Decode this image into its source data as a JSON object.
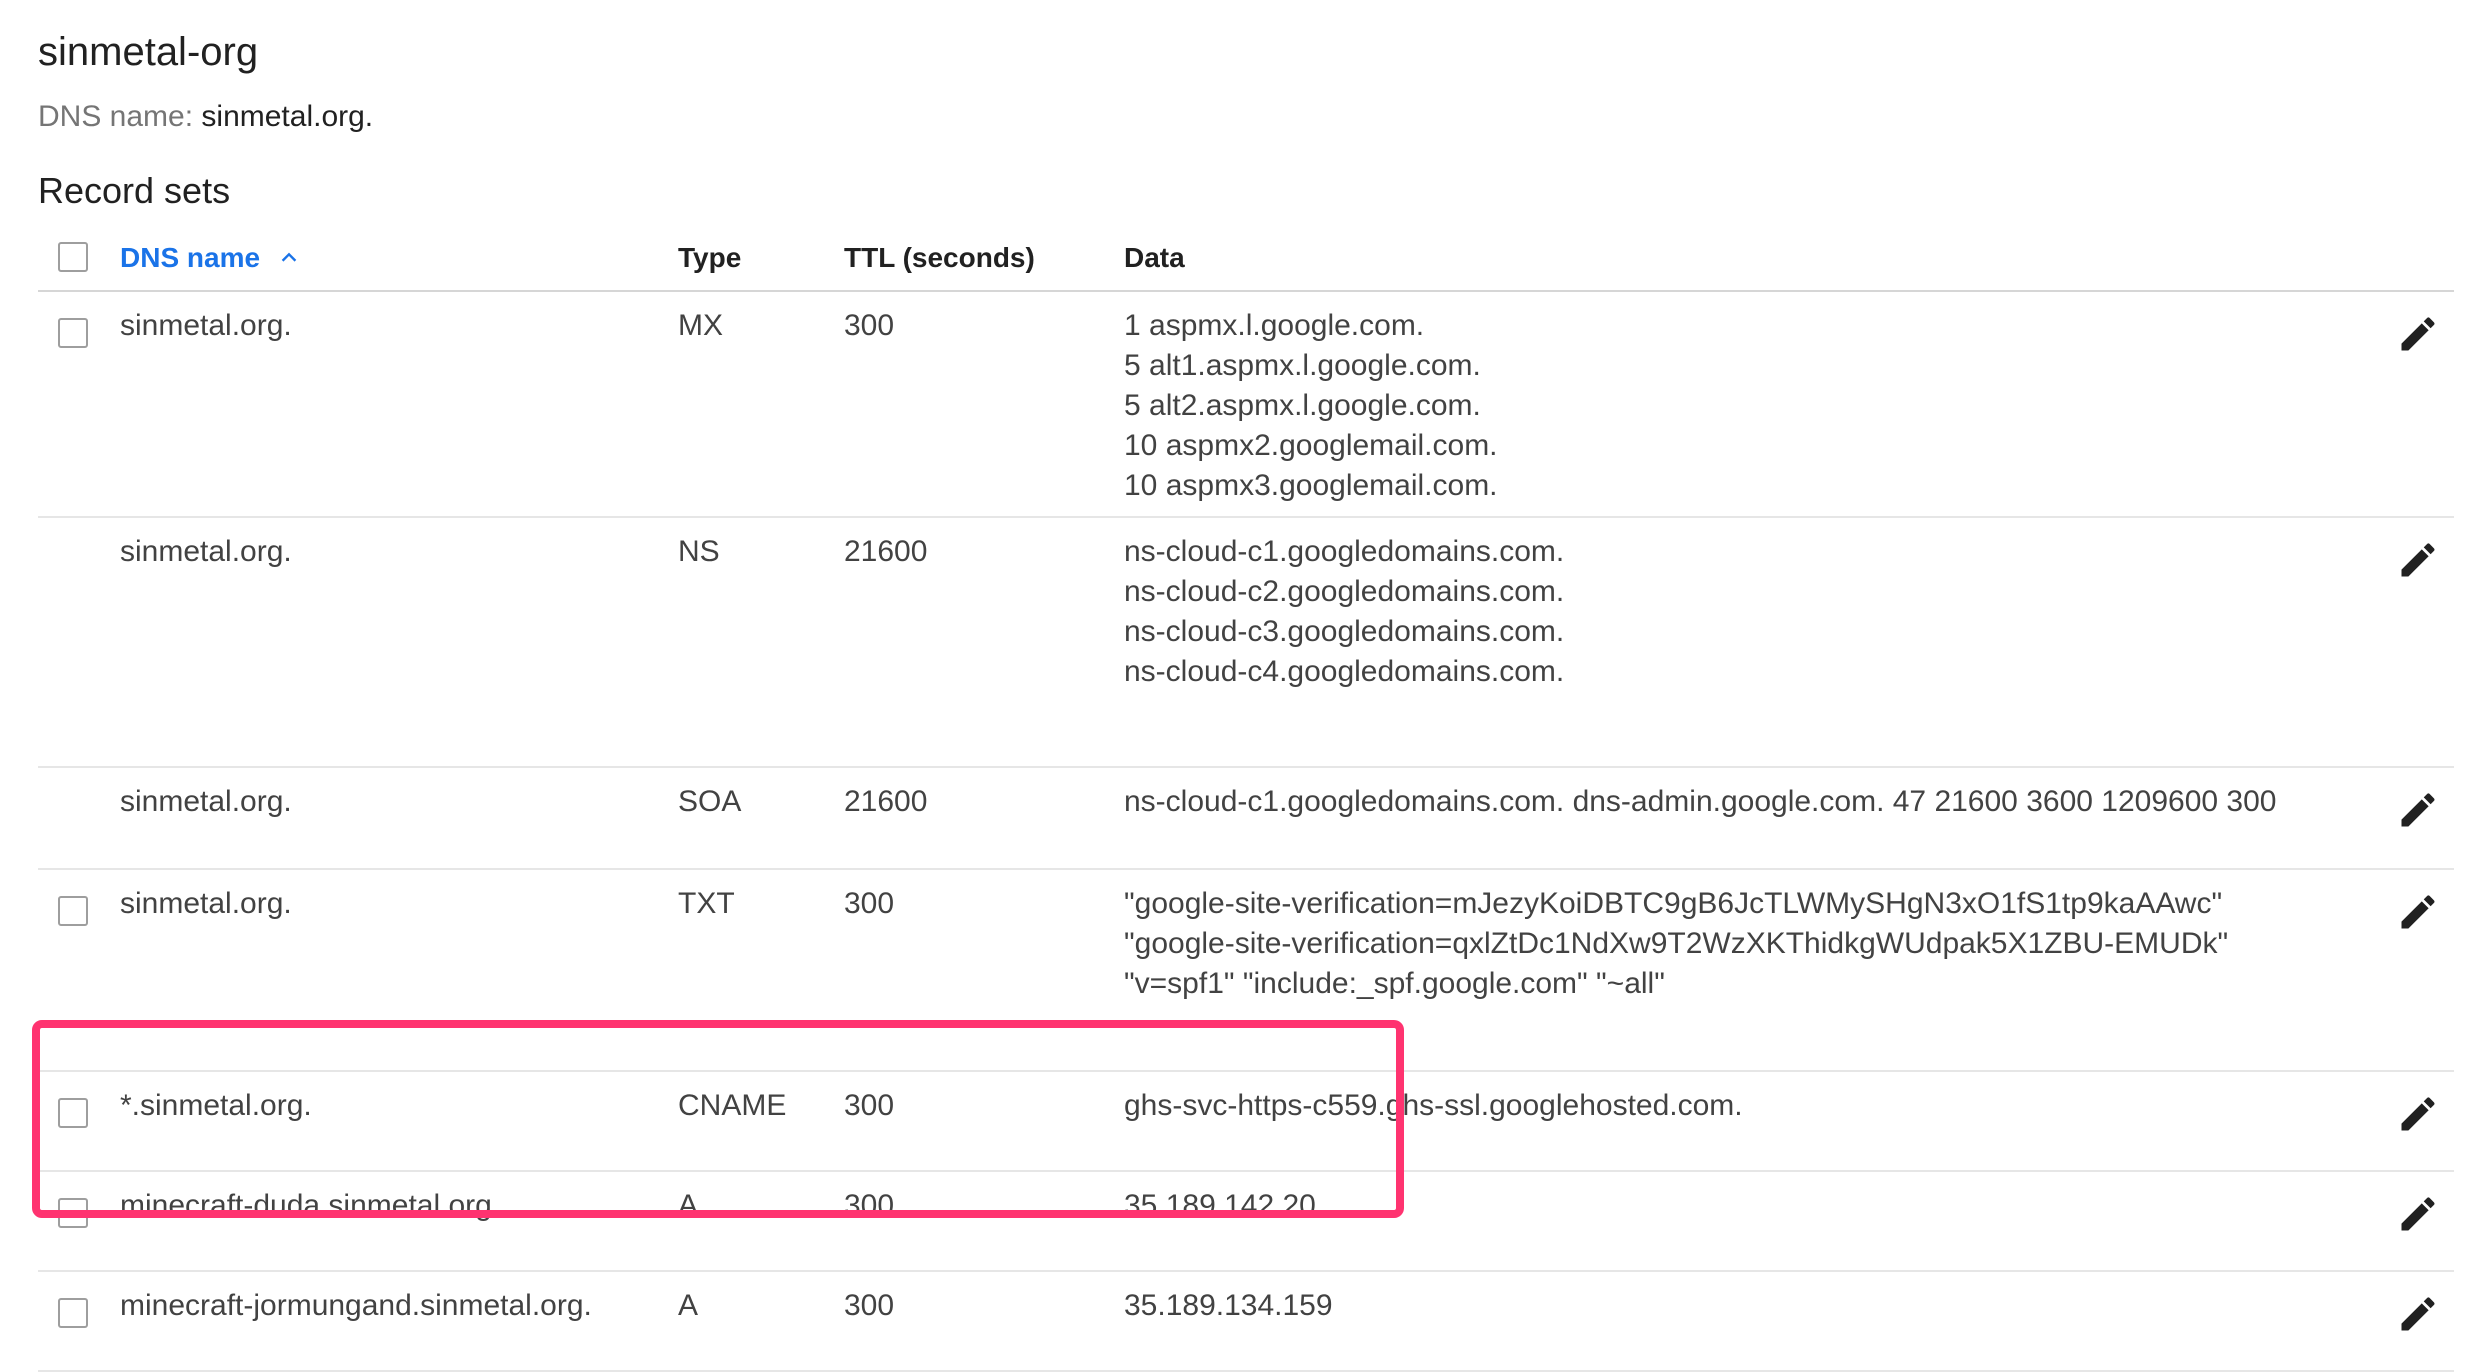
{
  "zone": {
    "title": "sinmetal-org",
    "dns_label": "DNS name:",
    "dns_value": "sinmetal.org."
  },
  "section_title": "Record sets",
  "table": {
    "headers": {
      "dns_name": "DNS name",
      "type": "Type",
      "ttl": "TTL (seconds)",
      "data": "Data"
    },
    "rows": [
      {
        "name": "sinmetal.org.",
        "type": "MX",
        "ttl": "300",
        "checkbox": true,
        "data": [
          "1 aspmx.l.google.com.",
          "5 alt1.aspmx.l.google.com.",
          "5 alt2.aspmx.l.google.com.",
          "10 aspmx2.googlemail.com.",
          "10 aspmx3.googlemail.com."
        ]
      },
      {
        "name": "sinmetal.org.",
        "type": "NS",
        "ttl": "21600",
        "checkbox": false,
        "data": [
          "ns-cloud-c1.googledomains.com.",
          "ns-cloud-c2.googledomains.com.",
          "ns-cloud-c3.googledomains.com.",
          "ns-cloud-c4.googledomains.com."
        ]
      },
      {
        "name": "sinmetal.org.",
        "type": "SOA",
        "ttl": "21600",
        "checkbox": false,
        "data": [
          "ns-cloud-c1.googledomains.com. dns-admin.google.com. 47 21600 3600 1209600 300"
        ]
      },
      {
        "name": "sinmetal.org.",
        "type": "TXT",
        "ttl": "300",
        "checkbox": true,
        "data": [
          "\"google-site-verification=mJezyKoiDBTC9gB6JcTLWMySHgN3xO1fS1tp9kaAAwc\"",
          "\"google-site-verification=qxlZtDc1NdXw9T2WzXKThidkgWUdpak5X1ZBU-EMUDk\"",
          "\"v=spf1\" \"include:_spf.google.com\" \"~all\""
        ]
      },
      {
        "name": "*.sinmetal.org.",
        "type": "CNAME",
        "ttl": "300",
        "checkbox": true,
        "data": [
          "ghs-svc-https-c559.ghs-ssl.googlehosted.com."
        ]
      },
      {
        "name": "minecraft-duda.sinmetal.org.",
        "type": "A",
        "ttl": "300",
        "checkbox": true,
        "data": [
          "35.189.142.20"
        ]
      },
      {
        "name": "minecraft-jormungand.sinmetal.org.",
        "type": "A",
        "ttl": "300",
        "checkbox": true,
        "data": [
          "35.189.134.159"
        ]
      }
    ]
  },
  "colors": {
    "accent": "#1a73e8",
    "highlight": "#ff3370"
  },
  "icons": {
    "sort": "arrow-up-icon",
    "edit": "pencil-icon"
  }
}
